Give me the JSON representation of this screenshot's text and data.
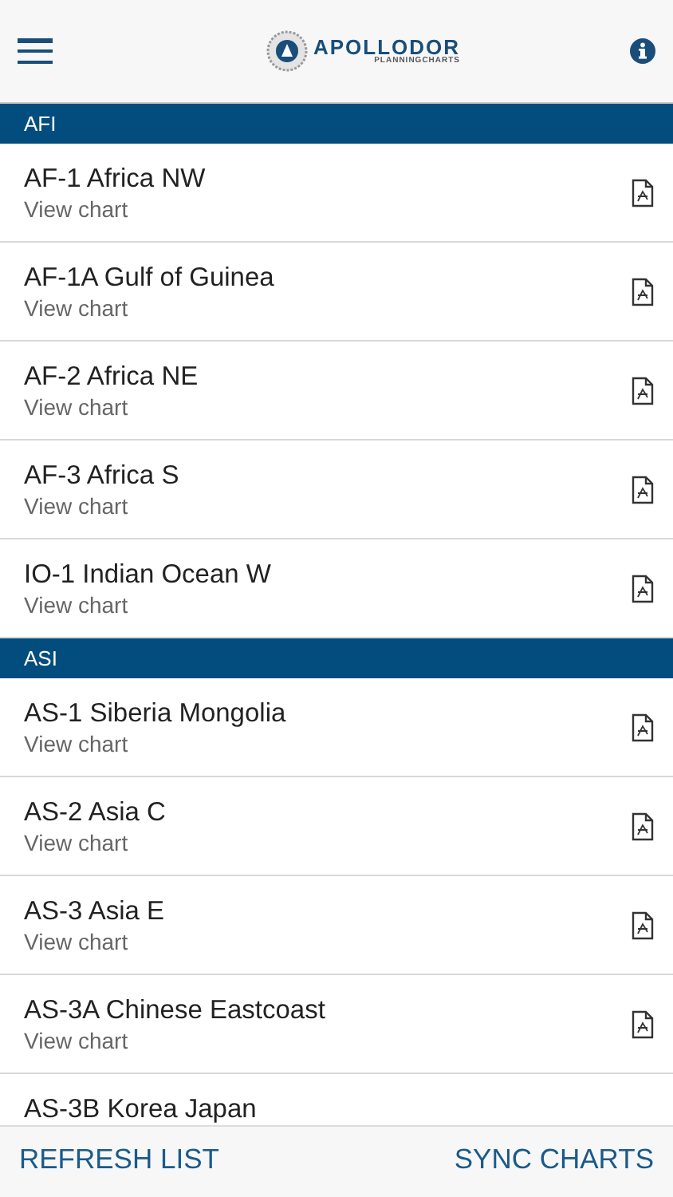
{
  "header": {
    "logo_title": "APOLLODOR",
    "logo_subtitle": "PLANNINGCHARTS"
  },
  "sections": [
    {
      "title": "AFI",
      "items": [
        {
          "title": "AF-1 Africa NW",
          "subtitle": "View chart"
        },
        {
          "title": "AF-1A Gulf of Guinea",
          "subtitle": "View chart"
        },
        {
          "title": "AF-2 Africa NE",
          "subtitle": "View chart"
        },
        {
          "title": "AF-3 Africa S",
          "subtitle": "View chart"
        },
        {
          "title": "IO-1 Indian Ocean W",
          "subtitle": "View chart"
        }
      ]
    },
    {
      "title": "ASI",
      "items": [
        {
          "title": "AS-1 Siberia Mongolia",
          "subtitle": "View chart"
        },
        {
          "title": "AS-2 Asia C",
          "subtitle": "View chart"
        },
        {
          "title": "AS-3 Asia E",
          "subtitle": "View chart"
        },
        {
          "title": "AS-3A Chinese Eastcoast",
          "subtitle": "View chart"
        },
        {
          "title": "AS-3B Korea Japan"
        }
      ]
    }
  ],
  "footer": {
    "buttons": [
      "REFRESH LIST",
      "SYNC CHARTS"
    ]
  }
}
